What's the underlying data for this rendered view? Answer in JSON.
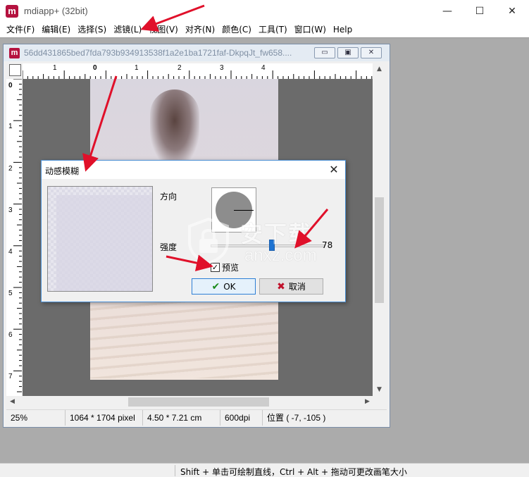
{
  "app": {
    "logo_letter": "m",
    "title": "mdiapp+ (32bit)",
    "window_controls": {
      "minimize": "—",
      "maximize": "☐",
      "close": "✕"
    }
  },
  "menu": [
    "文件(F)",
    "编辑(E)",
    "选择(S)",
    "滤镜(L)",
    "视图(V)",
    "对齐(N)",
    "颜色(C)",
    "工具(T)",
    "窗口(W)",
    "Help"
  ],
  "document": {
    "logo_letter": "m",
    "title": "56dd431865bed7fda793b934913538f1a2e1ba1721faf-DkpqJt_fw658....",
    "controls": {
      "minimize": "▭",
      "maximize": "▣",
      "close": "✕"
    },
    "ruler_top_labels": [
      "1",
      "0",
      "1",
      "2",
      "3",
      "4"
    ],
    "ruler_left_labels": [
      "0",
      "1",
      "2",
      "3",
      "4",
      "5",
      "6",
      "7"
    ],
    "status": {
      "zoom": "25%",
      "pixels": "1064 * 1704 pixel",
      "size": "4.50 * 7.21 cm",
      "dpi": "600dpi",
      "position": "位置 ( -7, -105 )"
    }
  },
  "dialog": {
    "title": "动感模糊",
    "direction_label": "方向",
    "strength_label": "强度",
    "strength": {
      "value": 78,
      "display": "78",
      "min": 0,
      "max": 100
    },
    "preview_label": "预览",
    "preview_checked": true,
    "ok_label": "OK",
    "cancel_label": "取消"
  },
  "watermark": {
    "cn": "安下载",
    "en": "anxz.com"
  },
  "status_bar": "Shift + 单击可绘制直线，Ctrl + Alt + 拖动可更改画笔大小",
  "colors": {
    "brand": "#b5123f",
    "accent": "#1e73d2",
    "arrow": "#e0102a",
    "workspace": "#ababab",
    "canvas_bg": "#6b6b6b"
  },
  "icons": {
    "ok": "checkmark-icon",
    "cancel": "x-icon"
  }
}
